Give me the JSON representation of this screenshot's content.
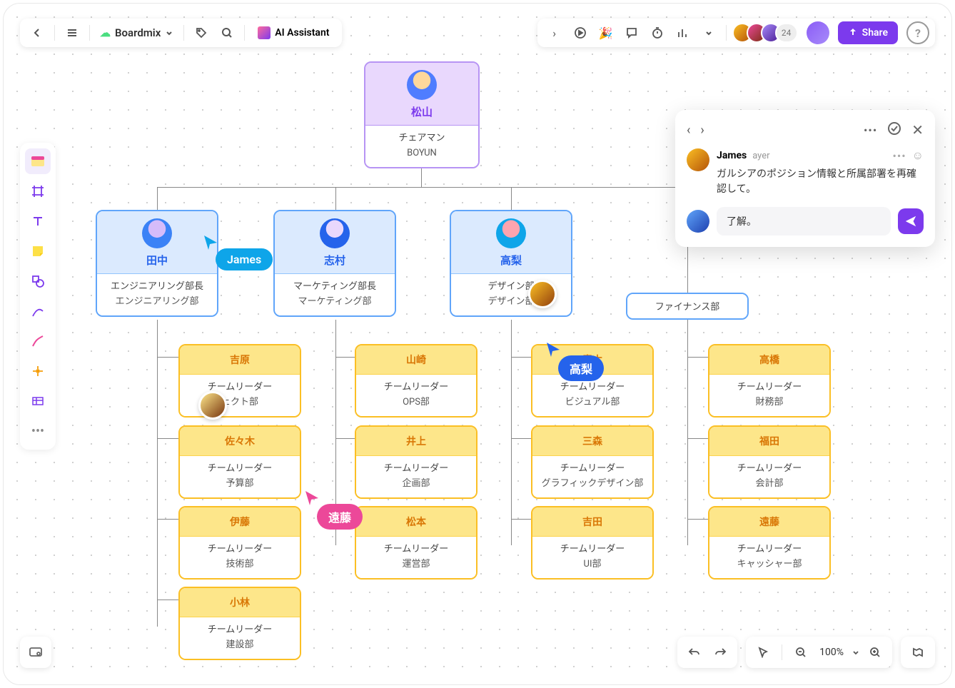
{
  "app": {
    "name": "Boardmix",
    "ai_assistant": "AI Assistant"
  },
  "collaborators": {
    "extra_count": "24"
  },
  "share_label": "Share",
  "zoom": "100%",
  "org": {
    "top": {
      "name": "松山",
      "title": "チェアマン",
      "dept": "BOYUN"
    },
    "blue": [
      {
        "name": "田中",
        "title": "エンジニアリング部長",
        "dept": "エンジニアリング部"
      },
      {
        "name": "志村",
        "title": "マーケティング部長",
        "dept": "マーケティング部"
      },
      {
        "name": "高梨",
        "title": "デザイン部",
        "dept": "デザイン部"
      },
      {
        "name": "",
        "title": "",
        "dept": "ファイナンス部"
      }
    ],
    "groups": [
      [
        {
          "name": "吉原",
          "title": "チームリーダー",
          "dept": "ェクト部"
        },
        {
          "name": "佐々木",
          "title": "チームリーダー",
          "dept": "予算部"
        },
        {
          "name": "伊藤",
          "title": "チームリーダー",
          "dept": "技術部"
        },
        {
          "name": "小林",
          "title": "チームリーダー",
          "dept": "建設部"
        }
      ],
      [
        {
          "name": "山崎",
          "title": "チームリーダー",
          "dept": "OPS部"
        },
        {
          "name": "井上",
          "title": "チームリーダー",
          "dept": "企画部"
        },
        {
          "name": "松本",
          "title": "チームリーダー",
          "dept": "運営部"
        }
      ],
      [
        {
          "name": "青木",
          "title": "チームリーダー",
          "dept": "ビジュアル部"
        },
        {
          "name": "三森",
          "title": "チームリーダー",
          "dept": "グラフィックデザイン部"
        },
        {
          "name": "吉田",
          "title": "チームリーダー",
          "dept": "UI部"
        }
      ],
      [
        {
          "name": "高橋",
          "title": "チームリーダー",
          "dept": "財務部"
        },
        {
          "name": "福田",
          "title": "チームリーダー",
          "dept": "会計部"
        },
        {
          "name": "遠藤",
          "title": "チームリーダー",
          "dept": "キャッシャー部"
        }
      ]
    ]
  },
  "cursors": {
    "james": "James",
    "takanashi": "高梨",
    "endo": "遠藤"
  },
  "comment": {
    "author": "James",
    "time": "ayer",
    "text": "ガルシアのポジション情報と所属部署を再確認して。",
    "reply": "了解。"
  }
}
